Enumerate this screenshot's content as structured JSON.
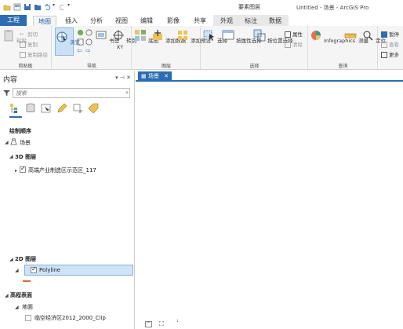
{
  "titlebar": {
    "contextual_group": "要素图层",
    "window_title": "Untitled - 场景 - ArcGIS Pro"
  },
  "tabs": {
    "project": "工程",
    "items": [
      "地图",
      "插入",
      "分析",
      "视图",
      "编辑",
      "影像",
      "共享"
    ],
    "contextual": [
      "外观",
      "标注",
      "数据"
    ]
  },
  "ribbon": {
    "clipboard": {
      "label": "剪贴板",
      "paste": "粘贴",
      "cut": "剪切",
      "copy": "复制",
      "copy_path": "复制路径"
    },
    "navigate": {
      "label": "导航",
      "explore": "浏览",
      "bookmarks": "书签",
      "goto_xy": "转到",
      "goto_xy_line2": "XY"
    },
    "layer": {
      "label": "图层",
      "basemap": "底图",
      "add_data": "添加数据",
      "add_preset": "添加预设"
    },
    "selection": {
      "label": "选择",
      "select": "选择",
      "by_attributes": "按属性选择",
      "by_location": "按位置选择",
      "attributes": "属性",
      "clear": "清除"
    },
    "inquiry": {
      "label": "查询",
      "infographics": "Infographics",
      "measure": "测量",
      "locate": "定位"
    },
    "extra": {
      "pause": "暂停",
      "view_unplaced": "查看",
      "more": "更多"
    }
  },
  "contents": {
    "title": "内容",
    "pane_controls": "▾ ⊣ ✕",
    "search_placeholder": "搜索",
    "drawing_order": "绘制顺序",
    "scene": "场景",
    "group_3d": "3D 图层",
    "layer_3d": "高端产业制造区示范区_117",
    "group_2d": "2D 图层",
    "layer_2d": "Polyline",
    "elevation": "高程表面",
    "ground": "地面",
    "elevation_source": "临空经济区2012_2000_Clip",
    "colors": {
      "polyline_swatch": "#e06a2b",
      "accent": "#2b6cb3"
    }
  },
  "map": {
    "tab_label": "场景",
    "tab_close": "✕"
  }
}
